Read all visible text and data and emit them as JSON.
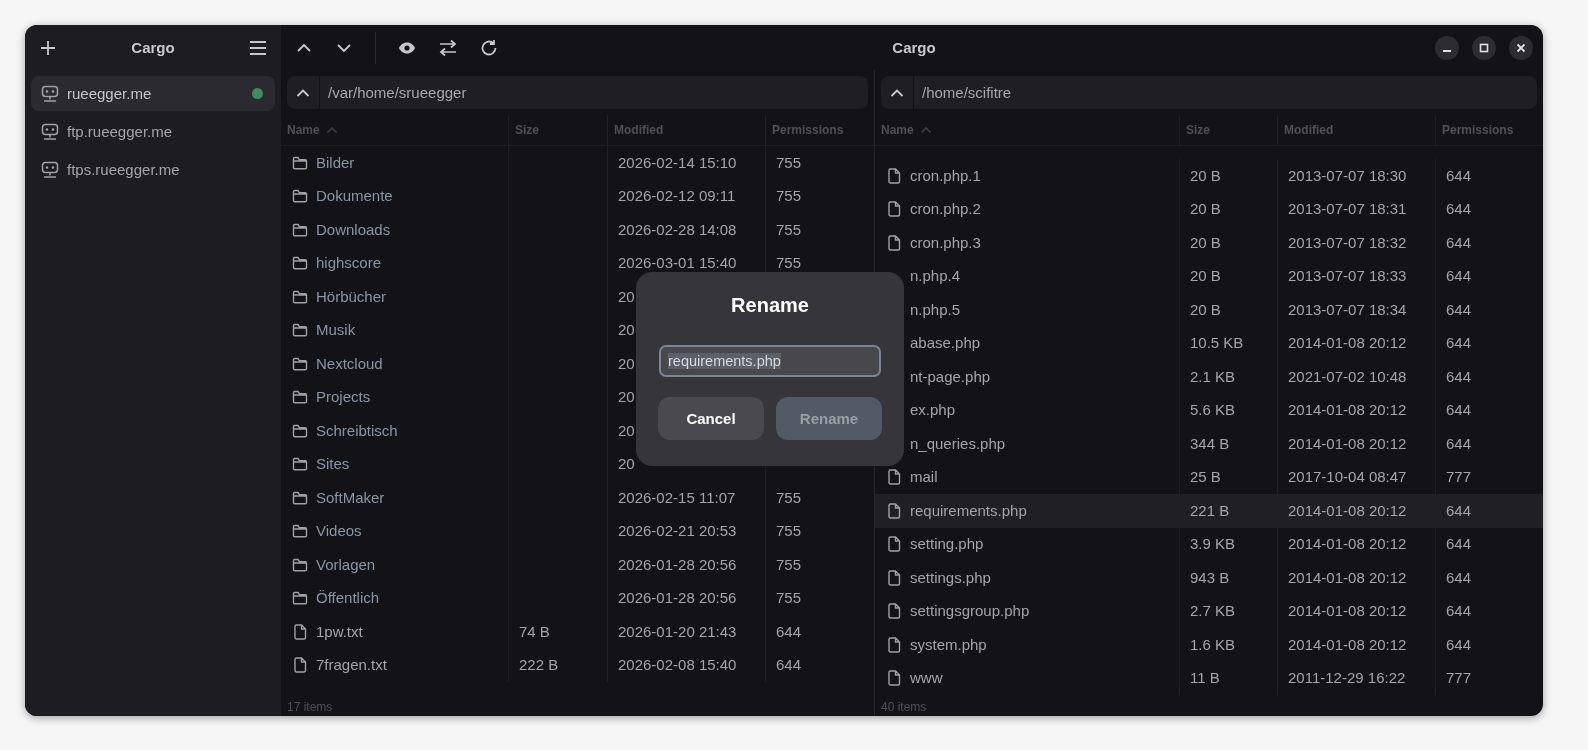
{
  "window": {
    "sidebar_title": "Cargo",
    "title": "Cargo"
  },
  "sidebar": {
    "items": [
      {
        "label": "rueegger.me",
        "selected": true,
        "connected": true
      },
      {
        "label": "ftp.rueegger.me",
        "selected": false,
        "connected": false
      },
      {
        "label": "ftps.rueegger.me",
        "selected": false,
        "connected": false
      }
    ]
  },
  "panes": [
    {
      "path": "/var/home/srueegger",
      "columns": [
        {
          "label": "Name",
          "sorted": true
        },
        {
          "label": "Size",
          "sorted": false
        },
        {
          "label": "Modified",
          "sorted": false
        },
        {
          "label": "Permissions",
          "sorted": false
        }
      ],
      "rows": [
        {
          "kind": "folder",
          "selected": false,
          "name": "Bilder",
          "modified": "2026-02-14 15:10",
          "permissions": "755"
        },
        {
          "kind": "folder",
          "selected": false,
          "name": "Dokumente",
          "modified": "2026-02-12 09:11",
          "permissions": "755"
        },
        {
          "kind": "folder",
          "selected": false,
          "name": "Downloads",
          "modified": "2026-02-28 14:08",
          "permissions": "755"
        },
        {
          "kind": "folder",
          "selected": false,
          "name": "highscore",
          "modified": "2026-03-01 15:40",
          "permissions": "755"
        },
        {
          "kind": "folder",
          "selected": false,
          "name": "Hörbücher",
          "modified": "20"
        },
        {
          "kind": "folder",
          "selected": false,
          "name": "Musik",
          "modified": "20"
        },
        {
          "kind": "folder",
          "selected": false,
          "name": "Nextcloud",
          "modified": "20"
        },
        {
          "kind": "folder",
          "selected": false,
          "name": "Projects",
          "modified": "20"
        },
        {
          "kind": "folder",
          "selected": false,
          "name": "Schreibtisch",
          "modified": "20"
        },
        {
          "kind": "folder",
          "selected": false,
          "name": "Sites",
          "modified": "20"
        },
        {
          "kind": "folder",
          "selected": false,
          "name": "SoftMaker",
          "modified": "2026-02-15 11:07",
          "permissions": "755"
        },
        {
          "kind": "folder",
          "selected": false,
          "name": "Videos",
          "modified": "2026-02-21 20:53",
          "permissions": "755"
        },
        {
          "kind": "folder",
          "selected": false,
          "name": "Vorlagen",
          "modified": "2026-01-28 20:56",
          "permissions": "755"
        },
        {
          "kind": "folder",
          "selected": false,
          "name": "Öffentlich",
          "modified": "2026-01-28 20:56",
          "permissions": "755"
        },
        {
          "kind": "file",
          "selected": false,
          "name": "1pw.txt",
          "size": "74 B",
          "modified": "2026-01-20 21:43",
          "permissions": "644"
        },
        {
          "kind": "file",
          "selected": false,
          "name": "7fragen.txt",
          "size": "222 B",
          "modified": "2026-02-08 15:40",
          "permissions": "644"
        }
      ],
      "footer": "17 items"
    },
    {
      "path": "/home/scifitre",
      "columns": [
        {
          "label": "Name",
          "sorted": true
        },
        {
          "label": "Size",
          "sorted": false
        },
        {
          "label": "Modified",
          "sorted": false
        },
        {
          "label": "Permissions",
          "sorted": false
        }
      ],
      "rows": [
        {
          "kind": "file",
          "selected": false,
          "name": "cron.php.1",
          "size": "20 B",
          "modified": "2013-07-07 18:30",
          "permissions": "644"
        },
        {
          "kind": "file",
          "selected": false,
          "name": "cron.php.2",
          "size": "20 B",
          "modified": "2013-07-07 18:31",
          "permissions": "644"
        },
        {
          "kind": "file",
          "selected": false,
          "name": "cron.php.3",
          "size": "20 B",
          "modified": "2013-07-07 18:32",
          "permissions": "644"
        },
        {
          "kind": "covered",
          "selected": false,
          "name": "n.php.4",
          "size": "20 B",
          "modified": "2013-07-07 18:33",
          "permissions": "644"
        },
        {
          "kind": "covered",
          "selected": false,
          "name": "n.php.5",
          "size": "20 B",
          "modified": "2013-07-07 18:34",
          "permissions": "644"
        },
        {
          "kind": "covered",
          "selected": false,
          "name": "abase.php",
          "size": "10.5 KB",
          "modified": "2014-01-08 20:12",
          "permissions": "644"
        },
        {
          "kind": "covered",
          "selected": false,
          "name": "nt-page.php",
          "size": "2.1 KB",
          "modified": "2021-07-02 10:48",
          "permissions": "644"
        },
        {
          "kind": "covered",
          "selected": false,
          "name": "ex.php",
          "size": "5.6 KB",
          "modified": "2014-01-08 20:12",
          "permissions": "644"
        },
        {
          "kind": "covered",
          "selected": false,
          "name": "n_queries.php",
          "size": "344 B",
          "modified": "2014-01-08 20:12",
          "permissions": "644"
        },
        {
          "kind": "file",
          "selected": false,
          "name": "mail",
          "size": "25 B",
          "modified": "2017-10-04 08:47",
          "permissions": "777"
        },
        {
          "kind": "file",
          "selected": true,
          "name": "requirements.php",
          "size": "221 B",
          "modified": "2014-01-08 20:12",
          "permissions": "644"
        },
        {
          "kind": "file",
          "selected": false,
          "name": "setting.php",
          "size": "3.9 KB",
          "modified": "2014-01-08 20:12",
          "permissions": "644"
        },
        {
          "kind": "file",
          "selected": false,
          "name": "settings.php",
          "size": "943 B",
          "modified": "2014-01-08 20:12",
          "permissions": "644"
        },
        {
          "kind": "file",
          "selected": false,
          "name": "settingsgroup.php",
          "size": "2.7 KB",
          "modified": "2014-01-08 20:12",
          "permissions": "644"
        },
        {
          "kind": "file",
          "selected": false,
          "name": "system.php",
          "size": "1.6 KB",
          "modified": "2014-01-08 20:12",
          "permissions": "644"
        },
        {
          "kind": "file",
          "selected": false,
          "name": "www",
          "size": "11 B",
          "modified": "2011-12-29 16:22",
          "permissions": "777"
        }
      ],
      "footer": "40 items"
    }
  ],
  "dialog": {
    "title": "Rename",
    "value": "requirements.php",
    "text_selected": true,
    "buttons": [
      {
        "label": "Cancel",
        "disabled": false
      },
      {
        "label": "Rename",
        "disabled": true
      }
    ]
  }
}
